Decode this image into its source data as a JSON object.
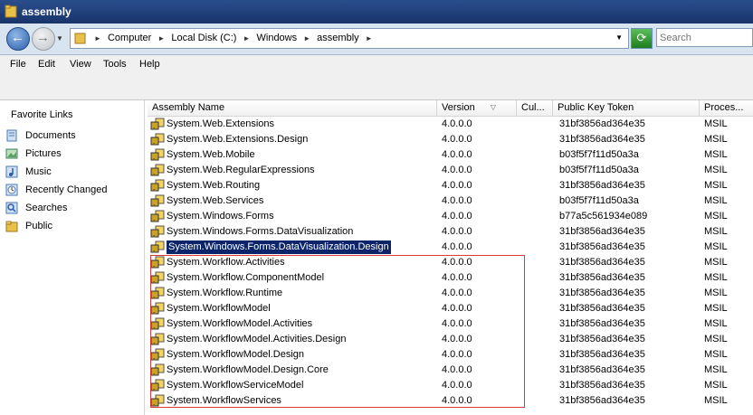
{
  "window": {
    "title": "assembly"
  },
  "address": {
    "crumbs": [
      "Computer",
      "Local Disk (C:)",
      "Windows",
      "assembly"
    ],
    "search_placeholder": "Search"
  },
  "menu": [
    "File",
    "Edit",
    "View",
    "Tools",
    "Help"
  ],
  "left_nav": {
    "header": "Favorite Links",
    "items": [
      {
        "label": "Documents",
        "icon": "documents-icon"
      },
      {
        "label": "Pictures",
        "icon": "pictures-icon"
      },
      {
        "label": "Music",
        "icon": "music-icon"
      },
      {
        "label": "Recently Changed",
        "icon": "recent-icon"
      },
      {
        "label": "Searches",
        "icon": "searches-icon"
      },
      {
        "label": "Public",
        "icon": "public-folder-icon"
      }
    ]
  },
  "columns": [
    "Assembly Name",
    "Version",
    "Cul...",
    "Public Key Token",
    "Proces..."
  ],
  "rows": [
    {
      "name": "System.Web.Extensions",
      "version": "4.0.0.0",
      "culture": "",
      "token": "31bf3856ad364e35",
      "arch": "MSIL"
    },
    {
      "name": "System.Web.Extensions.Design",
      "version": "4.0.0.0",
      "culture": "",
      "token": "31bf3856ad364e35",
      "arch": "MSIL"
    },
    {
      "name": "System.Web.Mobile",
      "version": "4.0.0.0",
      "culture": "",
      "token": "b03f5f7f11d50a3a",
      "arch": "MSIL"
    },
    {
      "name": "System.Web.RegularExpressions",
      "version": "4.0.0.0",
      "culture": "",
      "token": "b03f5f7f11d50a3a",
      "arch": "MSIL"
    },
    {
      "name": "System.Web.Routing",
      "version": "4.0.0.0",
      "culture": "",
      "token": "31bf3856ad364e35",
      "arch": "MSIL"
    },
    {
      "name": "System.Web.Services",
      "version": "4.0.0.0",
      "culture": "",
      "token": "b03f5f7f11d50a3a",
      "arch": "MSIL"
    },
    {
      "name": "System.Windows.Forms",
      "version": "4.0.0.0",
      "culture": "",
      "token": "b77a5c561934e089",
      "arch": "MSIL"
    },
    {
      "name": "System.Windows.Forms.DataVisualization",
      "version": "4.0.0.0",
      "culture": "",
      "token": "31bf3856ad364e35",
      "arch": "MSIL"
    },
    {
      "name": "System.Windows.Forms.DataVisualization.Design",
      "version": "4.0.0.0",
      "culture": "",
      "token": "31bf3856ad364e35",
      "arch": "MSIL",
      "selected": true
    },
    {
      "name": "System.Workflow.Activities",
      "version": "4.0.0.0",
      "culture": "",
      "token": "31bf3856ad364e35",
      "arch": "MSIL"
    },
    {
      "name": "System.Workflow.ComponentModel",
      "version": "4.0.0.0",
      "culture": "",
      "token": "31bf3856ad364e35",
      "arch": "MSIL"
    },
    {
      "name": "System.Workflow.Runtime",
      "version": "4.0.0.0",
      "culture": "",
      "token": "31bf3856ad364e35",
      "arch": "MSIL"
    },
    {
      "name": "System.WorkflowModel",
      "version": "4.0.0.0",
      "culture": "",
      "token": "31bf3856ad364e35",
      "arch": "MSIL"
    },
    {
      "name": "System.WorkflowModel.Activities",
      "version": "4.0.0.0",
      "culture": "",
      "token": "31bf3856ad364e35",
      "arch": "MSIL"
    },
    {
      "name": "System.WorkflowModel.Activities.Design",
      "version": "4.0.0.0",
      "culture": "",
      "token": "31bf3856ad364e35",
      "arch": "MSIL"
    },
    {
      "name": "System.WorkflowModel.Design",
      "version": "4.0.0.0",
      "culture": "",
      "token": "31bf3856ad364e35",
      "arch": "MSIL"
    },
    {
      "name": "System.WorkflowModel.Design.Core",
      "version": "4.0.0.0",
      "culture": "",
      "token": "31bf3856ad364e35",
      "arch": "MSIL"
    },
    {
      "name": "System.WorkflowServiceModel",
      "version": "4.0.0.0",
      "culture": "",
      "token": "31bf3856ad364e35",
      "arch": "MSIL"
    },
    {
      "name": "System.WorkflowServices",
      "version": "4.0.0.0",
      "culture": "",
      "token": "31bf3856ad364e35",
      "arch": "MSIL"
    }
  ],
  "colors": {
    "selection": "#0b246a",
    "highlight_box": "#d93a3a",
    "titlebar": "#1f3f7a"
  }
}
